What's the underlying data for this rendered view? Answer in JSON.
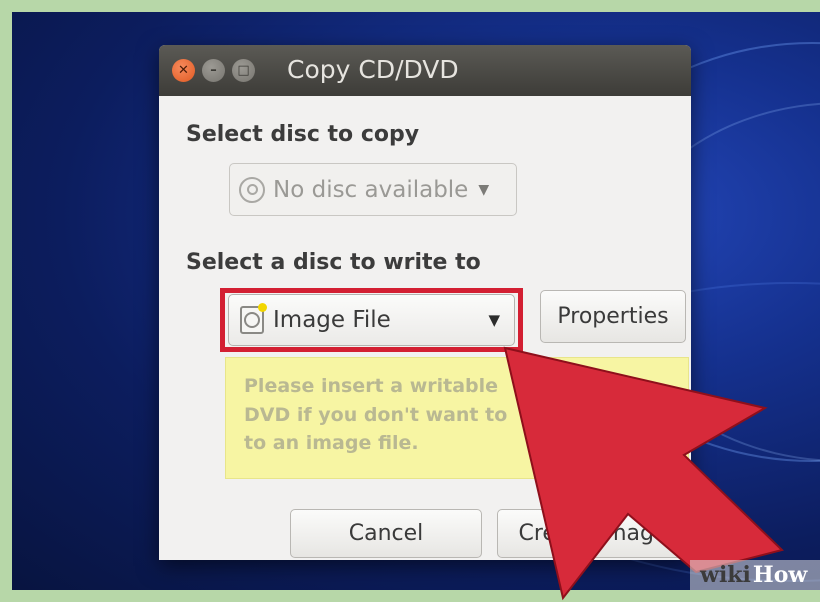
{
  "window": {
    "title": "Copy CD/DVD",
    "close_glyph": "✕",
    "minimize_glyph": "–",
    "maximize_glyph": "□"
  },
  "source": {
    "label": "Select disc to copy",
    "selected": "No disc available",
    "icon": "disc-icon",
    "enabled": false
  },
  "destination": {
    "label": "Select a disc to write to",
    "selected": "Image File",
    "icon": "image-file-icon",
    "properties_label": "Properties"
  },
  "info_message": "Please insert a writable\nDVD if you don't want to\nto an image file.",
  "buttons": {
    "cancel": "Cancel",
    "create": "Create Image"
  },
  "watermark": {
    "part1": "wiki",
    "part2": "How"
  },
  "colors": {
    "highlight": "#d31f32",
    "arrow": "#d72a3a",
    "info_bg": "#f7f5a3"
  }
}
